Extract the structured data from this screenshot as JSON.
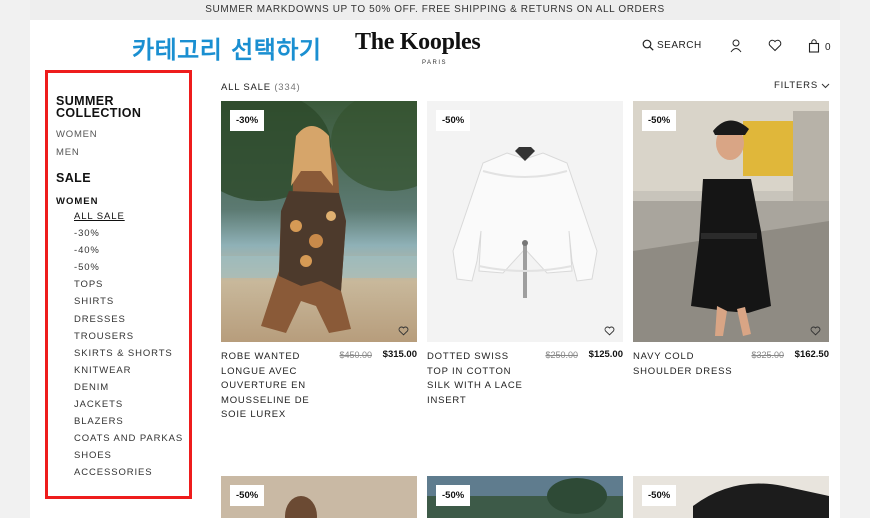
{
  "promo": {
    "text": "SUMMER MARKDOWNS UP TO 50% OFF. FREE SHIPPING & RETURNS ON ALL ORDERS"
  },
  "annotation": {
    "label": "카테고리 선택하기"
  },
  "header": {
    "logo": "The Kooples",
    "logo_sub": "PARIS",
    "search_label": "SEARCH",
    "bag_count": "0",
    "icons": [
      "search-icon",
      "account-icon",
      "heart-icon",
      "bag-icon"
    ]
  },
  "sidebar": {
    "summer_heading_line1": "SUMMER",
    "summer_heading_line2": "COLLECTION",
    "summer_links": [
      "WOMEN",
      "MEN"
    ],
    "sale_heading": "SALE",
    "women_label": "WOMEN",
    "categories": [
      "ALL SALE",
      "-30%",
      "-40%",
      "-50%",
      "TOPS",
      "SHIRTS",
      "DRESSES",
      "TROUSERS",
      "SKIRTS & SHORTS",
      "KNITWEAR",
      "DENIM",
      "JACKETS",
      "BLAZERS",
      "COATS AND PARKAS",
      "SHOES",
      "ACCESSORIES"
    ],
    "active_category": "ALL SALE"
  },
  "listing": {
    "title": "ALL SALE",
    "count": "(334)",
    "filters_label": "FILTERS"
  },
  "products": [
    {
      "badge": "-30%",
      "name": "ROBE WANTED LONGUE AVEC OUVERTURE EN MOUSSELINE DE SOIE LUREX",
      "old_price": "$450.00",
      "new_price": "$315.00"
    },
    {
      "badge": "-50%",
      "name": "DOTTED SWISS TOP IN COTTON SILK WITH A LACE INSERT",
      "old_price": "$250.00",
      "new_price": "$125.00"
    },
    {
      "badge": "-50%",
      "name": "NAVY COLD SHOULDER DRESS",
      "old_price": "$325.00",
      "new_price": "$162.50"
    }
  ],
  "products_row2": [
    {
      "badge": "-50%"
    },
    {
      "badge": "-50%"
    },
    {
      "badge": "-50%"
    }
  ],
  "colors": {
    "annotation": "#1a8fd1",
    "highlight_border": "#ee1c1c"
  }
}
